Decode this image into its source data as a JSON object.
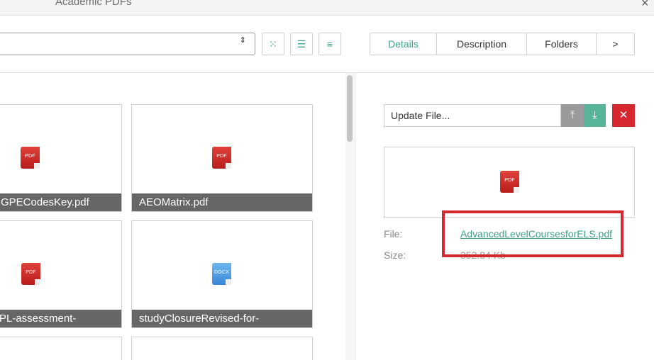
{
  "window": {
    "title": "Academic PDFs",
    "close_glyph": "×"
  },
  "toolbar": {
    "select_arrows": "⇕",
    "view_buttons": [
      {
        "name": "grid-view-icon",
        "glyph": "⁙"
      },
      {
        "name": "list-view-icon",
        "glyph": "☰"
      },
      {
        "name": "compact-list-icon",
        "glyph": "≡"
      }
    ]
  },
  "tabs": [
    {
      "label": "Details",
      "active": true
    },
    {
      "label": "Description",
      "active": false
    },
    {
      "label": "Folders",
      "active": false
    },
    {
      "label": ">",
      "active": false
    }
  ],
  "tiles": [
    {
      "caption": "GPECodesKey.pdf",
      "type": "PDF"
    },
    {
      "caption": "AEOMatrix.pdf",
      "type": "PDF"
    },
    {
      "caption": "PL-assessment-",
      "type": "PDF"
    },
    {
      "caption": "studyClosureRevised-for-",
      "type": "DOCX"
    }
  ],
  "details": {
    "update_placeholder": "Update File...",
    "preview_type": "PDF",
    "file_label": "File:",
    "file_name": "AdvancedLevelCoursesforELS.pdf",
    "size_label": "Size:",
    "size_value": "352.84 Kb"
  },
  "colors": {
    "accent": "#3fa087",
    "delete": "#d7282f",
    "upload": "#9a9a9a",
    "download": "#56b49b",
    "highlight": "#d7282f"
  }
}
